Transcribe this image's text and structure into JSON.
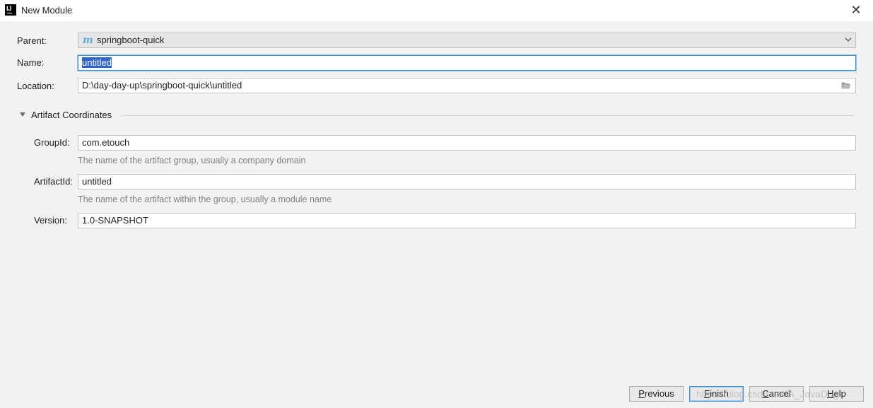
{
  "window": {
    "title": "New Module",
    "icon_text": "IJ"
  },
  "form": {
    "parent": {
      "label": "Parent:",
      "value": "springboot-quick",
      "icon": "maven-module-icon"
    },
    "name": {
      "label": "Name:",
      "value": "untitled"
    },
    "location": {
      "label": "Location:",
      "value": "D:\\day-day-up\\springboot-quick\\untitled"
    }
  },
  "artifact": {
    "section_title": "Artifact Coordinates",
    "group_id": {
      "label": "GroupId:",
      "value": "com.etouch",
      "hint": "The name of the artifact group, usually a company domain"
    },
    "artifact_id": {
      "label": "ArtifactId:",
      "value": "untitled",
      "hint": "The name of the artifact within the group, usually a module name"
    },
    "version": {
      "label": "Version:",
      "value": "1.0-SNAPSHOT"
    }
  },
  "buttons": {
    "previous": {
      "mnemonic": "P",
      "rest": "revious"
    },
    "finish": {
      "mnemonic": "F",
      "rest": "inish"
    },
    "cancel": {
      "mnemonic": "C",
      "rest": "ancel"
    },
    "help": {
      "mnemonic": "H",
      "rest": "elp"
    }
  },
  "watermark": "https://blog.csdn.net/A_JavaDog",
  "colors": {
    "accent": "#3b8fd1",
    "selection": "#2f65ca",
    "maven_icon": "#5aaedb"
  }
}
